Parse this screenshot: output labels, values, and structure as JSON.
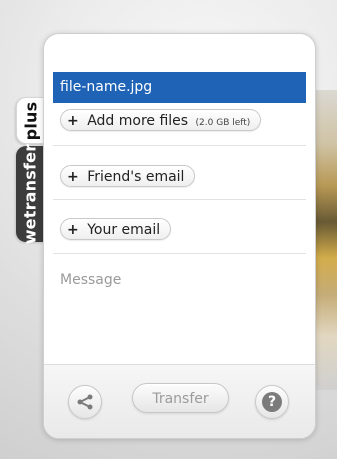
{
  "tabs": {
    "plus_label": "plus",
    "wetransfer_label": "wetransfer"
  },
  "upload": {
    "file_name": "file-name.jpg",
    "add_more_label": "Add more files",
    "add_more_capacity": "(2.0 GB left)"
  },
  "fields": {
    "friends_email_label": "Friend's email",
    "your_email_label": "Your email",
    "message_placeholder": "Message"
  },
  "footer": {
    "transfer_label": "Transfer",
    "share_icon": "share-icon",
    "help_icon": "help-icon",
    "help_glyph": "?"
  },
  "colors": {
    "file_highlight": "#1f63b7",
    "tab_dark": "#3c3c3c"
  }
}
